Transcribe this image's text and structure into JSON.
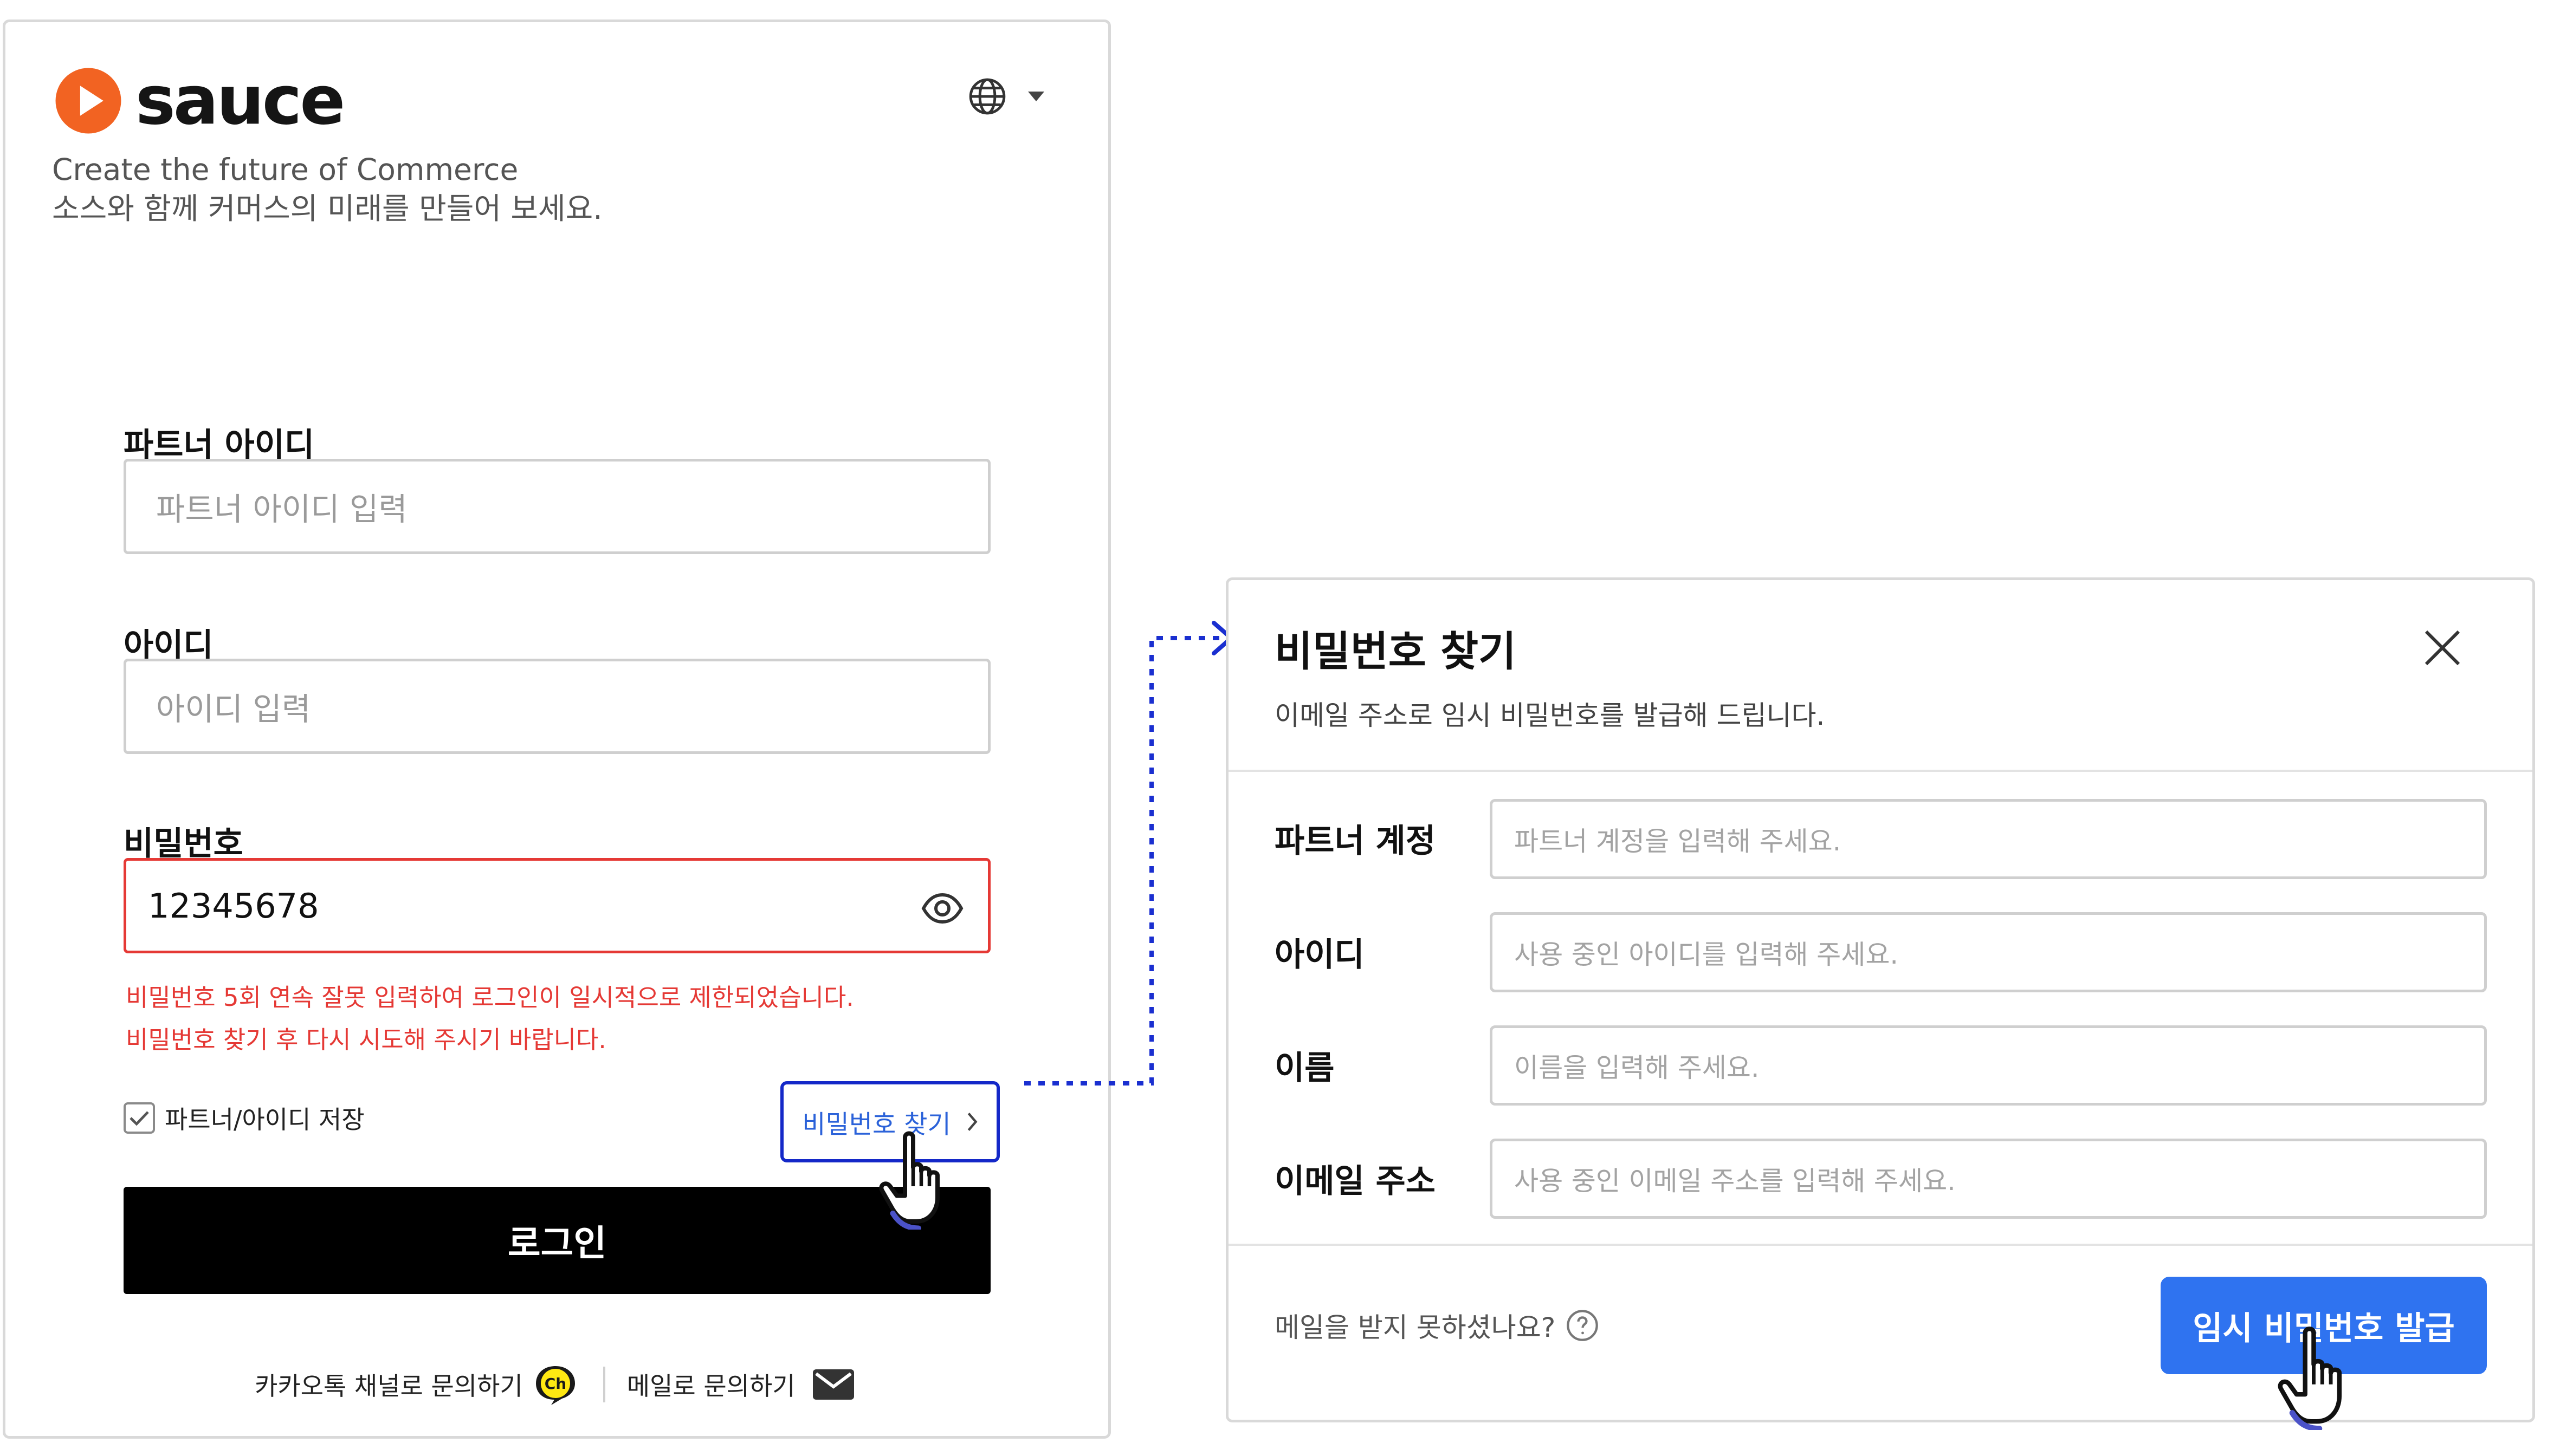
{
  "brand": {
    "name": "sauce",
    "slogan_en": "Create the future of Commerce",
    "slogan_ko": "소스와 함께 커머스의 미래를 만들어 보세요.",
    "accent_color": "#f26322"
  },
  "header": {
    "language_icon": "globe-icon",
    "dropdown_icon": "caret-down-icon"
  },
  "login": {
    "partner_id": {
      "label": "파트너 아이디",
      "placeholder": "파트너 아이디 입력",
      "value": ""
    },
    "user_id": {
      "label": "아이디",
      "placeholder": "아이디 입력",
      "value": ""
    },
    "password": {
      "label": "비밀번호",
      "value": "12345678",
      "toggle_icon": "eye-icon"
    },
    "error_lines": [
      "비밀번호 5회 연속 잘못 입력하여 로그인이 일시적으로 제한되었습니다.",
      "비밀번호 찾기 후 다시 시도해 주시기 바랍니다."
    ],
    "remember_label": "파트너/아이디 저장",
    "remember_checked": true,
    "find_password_label": "비밀번호 찾기",
    "submit_label": "로그인",
    "contact_kakao": "카카오톡 채널로 문의하기",
    "kakao_badge": "Ch",
    "contact_mail": "메일로 문의하기"
  },
  "modal": {
    "title": "비밀번호 찾기",
    "description": "이메일 주소로 임시 비밀번호를 발급해 드립니다.",
    "fields": [
      {
        "label": "파트너 계정",
        "placeholder": "파트너 계정을 입력해 주세요."
      },
      {
        "label": "아이디",
        "placeholder": "사용 중인 아이디를 입력해 주세요."
      },
      {
        "label": "이름",
        "placeholder": "이름을 입력해 주세요."
      },
      {
        "label": "이메일 주소",
        "placeholder": "사용 중인 이메일 주소를 입력해 주세요."
      }
    ],
    "help_text": "메일을 받지 못하셨나요?",
    "submit_label": "임시 비밀번호 발급"
  },
  "colors": {
    "error": "#e53935",
    "primary": "#2f73f0",
    "highlight_outline": "#1428c8",
    "login_button": "#000000"
  }
}
